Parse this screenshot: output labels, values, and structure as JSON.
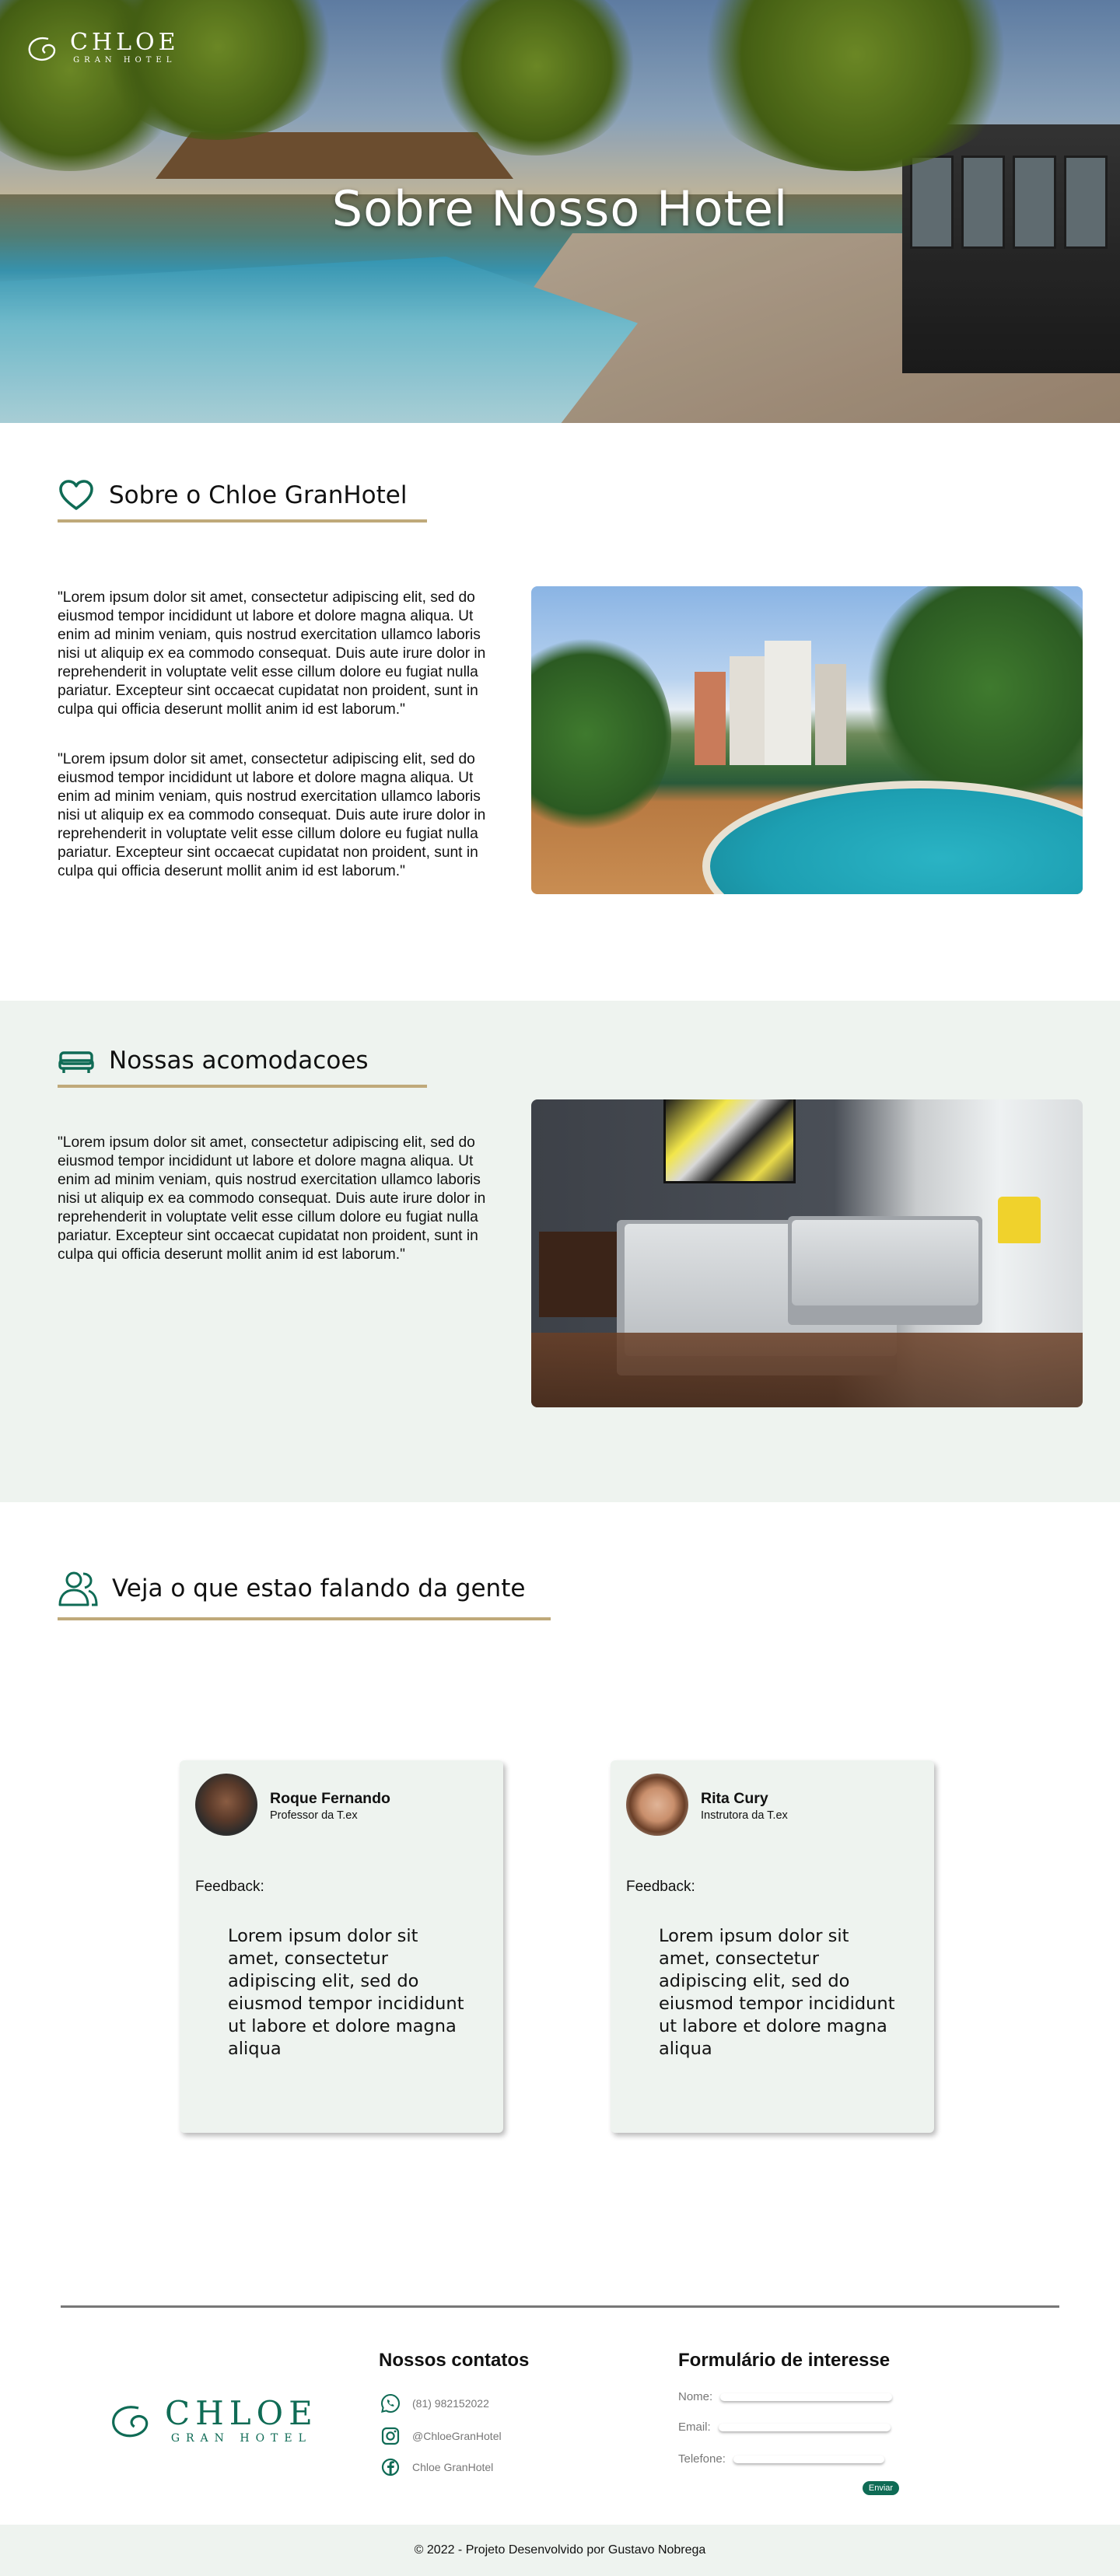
{
  "brand": {
    "name": "CHLOE",
    "sub": "GRAN HOTEL",
    "accent": "#0f6b55",
    "gold": "#bfa97a",
    "mint": "#eef3ef"
  },
  "hero": {
    "title": "Sobre Nosso Hotel"
  },
  "about": {
    "icon": "heart-icon",
    "title": "Sobre o Chloe GranHotel",
    "paragraphs": [
      "\"Lorem ipsum dolor sit amet, consectetur adipiscing elit, sed do eiusmod tempor incididunt ut labore et dolore magna aliqua. Ut enim ad minim veniam, quis nostrud exercitation ullamco laboris nisi ut aliquip ex ea commodo consequat. Duis aute irure dolor in reprehenderit in voluptate velit esse cillum dolore eu fugiat nulla pariatur. Excepteur sint occaecat cupidatat non proident, sunt in culpa qui officia deserunt mollit anim id est laborum.\"",
      "\"Lorem ipsum dolor sit amet, consectetur adipiscing elit, sed do eiusmod tempor incididunt ut labore et dolore magna aliqua. Ut enim ad minim veniam, quis nostrud exercitation ullamco laboris nisi ut aliquip ex ea commodo consequat. Duis aute irure dolor in reprehenderit in voluptate velit esse cillum dolore eu fugiat nulla pariatur. Excepteur sint occaecat cupidatat non proident, sunt in culpa qui officia deserunt mollit anim id est laborum.\""
    ]
  },
  "rooms": {
    "icon": "bed-icon",
    "title": "Nossas acomodacoes",
    "paragraph": "\"Lorem ipsum dolor sit amet, consectetur adipiscing elit, sed do eiusmod tempor incididunt ut labore et dolore magna aliqua. Ut enim ad minim veniam, quis nostrud exercitation ullamco laboris nisi ut aliquip ex ea commodo consequat. Duis aute irure dolor in reprehenderit in voluptate velit esse cillum dolore eu fugiat nulla pariatur. Excepteur sint occaecat cupidatat non proident, sunt in culpa qui officia deserunt mollit anim id est laborum.\""
  },
  "testimonials": {
    "icon": "users-icon",
    "title": "Veja o que estao falando da gente",
    "items": [
      {
        "name": "Roque Fernando",
        "role": "Professor da T.ex",
        "feedback_label": "Feedback:",
        "text": "Lorem ipsum dolor sit amet, consectetur adipiscing elit, sed do eiusmod tempor incididunt ut labore et dolore magna aliqua"
      },
      {
        "name": "Rita Cury",
        "role": "Instrutora da T.ex",
        "feedback_label": "Feedback:",
        "text": "Lorem ipsum dolor sit amet, consectetur adipiscing elit, sed do eiusmod tempor incididunt ut labore et dolore magna aliqua"
      }
    ]
  },
  "footer": {
    "contacts_title": "Nossos contatos",
    "contacts": [
      {
        "icon": "whatsapp-icon",
        "text": "(81) 982152022"
      },
      {
        "icon": "instagram-icon",
        "text": "@ChloeGranHotel"
      },
      {
        "icon": "facebook-icon",
        "text": "Chloe GranHotel"
      }
    ],
    "form_title": "Formulário de interesse",
    "form": {
      "name_label": "Nome:",
      "email_label": "Email:",
      "phone_label": "Telefone:",
      "submit": "Enviar"
    },
    "copyright": "© 2022 - Projeto Desenvolvido por Gustavo Nobrega"
  }
}
